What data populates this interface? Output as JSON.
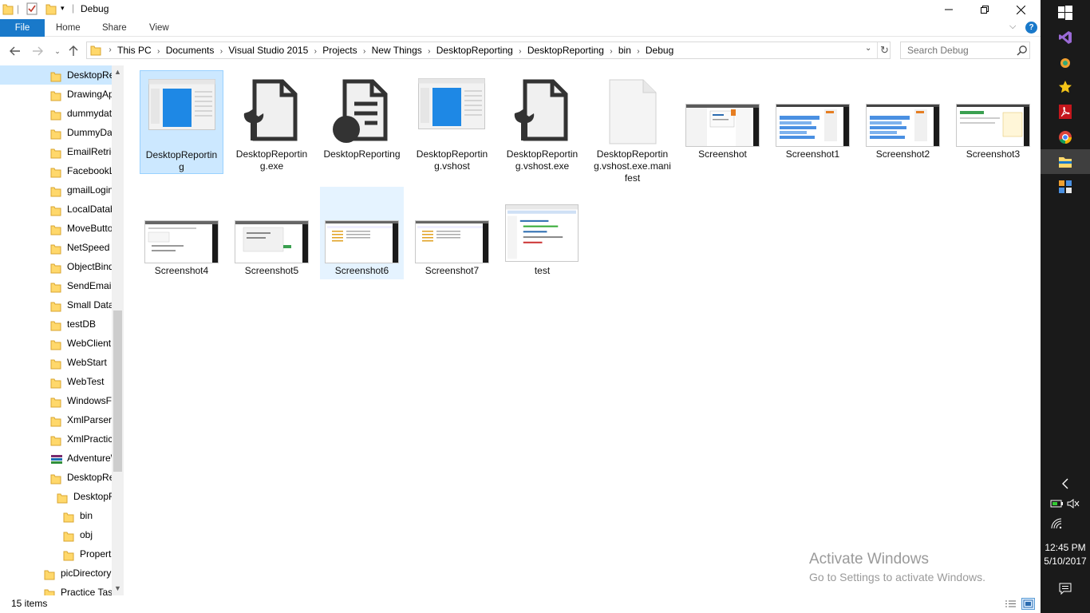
{
  "window": {
    "title": "Debug"
  },
  "ribbon": {
    "tabs": [
      "File",
      "Home",
      "Share",
      "View"
    ]
  },
  "address": {
    "breadcrumbs": [
      "This PC",
      "Documents",
      "Visual Studio 2015",
      "Projects",
      "New Things",
      "DesktopReporting",
      "DesktopReporting",
      "bin",
      "Debug"
    ]
  },
  "search": {
    "placeholder": "Search Debug"
  },
  "nav": {
    "items": [
      "DesktopReporting",
      "DrawingApp",
      "dummydata",
      "DummyData",
      "EmailRetrieve",
      "FacebookLogin",
      "gmailLogin",
      "LocalDatabase",
      "MoveButton",
      "NetSpeed",
      "ObjectBinding",
      "SendEmail",
      "Small Database",
      "testDB",
      "WebClient",
      "WebStart",
      "WebTest",
      "WindowsFormsApp",
      "XmlParser",
      "XmlPractice",
      "AdventureWorks",
      "DesktopReporting",
      "DesktopReporting",
      "bin",
      "obj",
      "Properties",
      "picDirectory",
      "Practice Task"
    ]
  },
  "files": [
    {
      "name": "DesktopReporting",
      "icon": "application-icon"
    },
    {
      "name": "DesktopReporting.exe",
      "icon": "config-file-icon"
    },
    {
      "name": "DesktopReporting",
      "icon": "pdb-file-icon"
    },
    {
      "name": "DesktopReporting.vshost",
      "icon": "application-icon"
    },
    {
      "name": "DesktopReporting.vshost.exe",
      "icon": "config-file-icon"
    },
    {
      "name": "DesktopReporting.vshost.exe.manifest",
      "icon": "blank-file-icon"
    },
    {
      "name": "Screenshot",
      "icon": "screenshot-thumbnail"
    },
    {
      "name": "Screenshot1",
      "icon": "screenshot-thumbnail"
    },
    {
      "name": "Screenshot2",
      "icon": "screenshot-thumbnail"
    },
    {
      "name": "Screenshot3",
      "icon": "screenshot-thumbnail"
    },
    {
      "name": "Screenshot4",
      "icon": "screenshot-thumbnail"
    },
    {
      "name": "Screenshot5",
      "icon": "screenshot-thumbnail"
    },
    {
      "name": "Screenshot6",
      "icon": "screenshot-thumbnail"
    },
    {
      "name": "Screenshot7",
      "icon": "screenshot-thumbnail"
    },
    {
      "name": "test",
      "icon": "screenshot-thumbnail"
    }
  ],
  "status": {
    "items": "15 items"
  },
  "watermark": {
    "line1": "Activate Windows",
    "line2": "Go to Settings to activate Windows."
  },
  "taskbar": {
    "time": "12:45 PM",
    "date": "5/10/2017"
  },
  "colors": {
    "accent": "#1979ca",
    "selection": "#cce8ff",
    "folder": "#ffd86b",
    "taskbar": "#1a1a1a"
  }
}
